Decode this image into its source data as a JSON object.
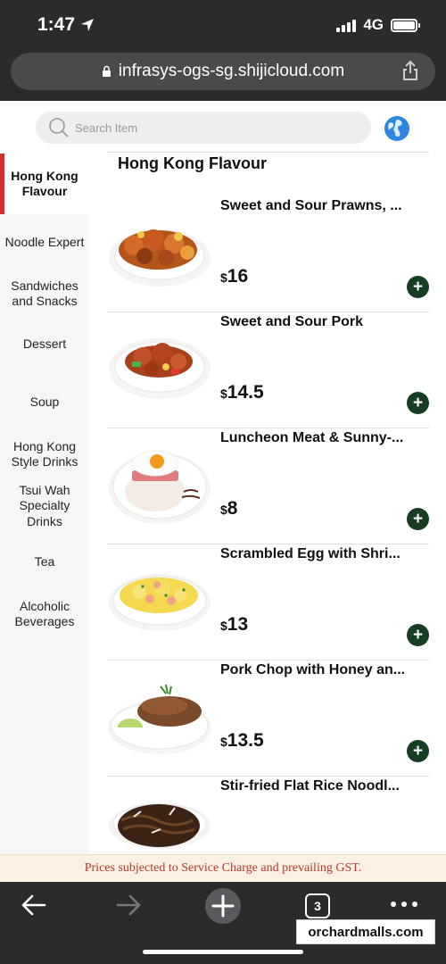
{
  "status_bar": {
    "time": "1:47",
    "network": "4G"
  },
  "browser": {
    "url": "infrasys-ogs-sg.shijicloud.com",
    "tab_count": "3"
  },
  "search": {
    "placeholder": "Search Item"
  },
  "categories": [
    {
      "label": "Hong Kong Flavour",
      "active": true
    },
    {
      "label": "Noodle Expert"
    },
    {
      "label": "Sandwiches and Snacks"
    },
    {
      "label": "Dessert"
    },
    {
      "label": "Soup"
    },
    {
      "label": "Hong Kong Style Drinks"
    },
    {
      "label": "Tsui Wah Specialty Drinks"
    },
    {
      "label": "Tea"
    },
    {
      "label": "Alcoholic Beverages"
    }
  ],
  "section": {
    "title": "Hong Kong Flavour"
  },
  "items": [
    {
      "name": "Sweet and Sour Prawns, ...",
      "currency": "$",
      "price": "16"
    },
    {
      "name": "Sweet and Sour Pork",
      "currency": "$",
      "price": "14.5"
    },
    {
      "name": "Luncheon Meat & Sunny-...",
      "currency": "$",
      "price": "8"
    },
    {
      "name": "Scrambled Egg with Shri...",
      "currency": "$",
      "price": "13"
    },
    {
      "name": "Pork Chop with Honey an...",
      "currency": "$",
      "price": "13.5"
    },
    {
      "name": "Stir-fried Flat Rice Noodl...",
      "currency": "$",
      "price": ""
    }
  ],
  "banner": {
    "text": "Prices subjected to Service Charge and prevailing GST."
  },
  "watermark": {
    "text": "orchardmalls.com"
  },
  "colors": {
    "accent_red": "#d32f2f",
    "add_button_green": "#173d22",
    "banner_text": "#b23a2c"
  }
}
